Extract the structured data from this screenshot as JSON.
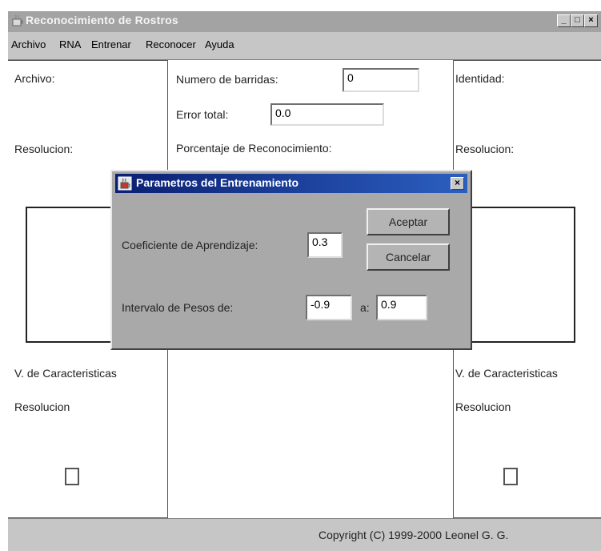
{
  "window": {
    "title": "Reconocimiento de Rostros",
    "controls": {
      "minimize": "_",
      "maximize": "□",
      "close": "×"
    }
  },
  "menu": [
    "Archivo",
    "RNA",
    "Entrenar",
    "Reconocer",
    "Ayuda"
  ],
  "left_panel": {
    "archivo_label": "Archivo:",
    "resolucion_label": "Resolucion:",
    "vector_label": "V. de Caracteristicas",
    "resolucion2_label": "Resolucion"
  },
  "center_panel": {
    "barridas_label": "Numero de barridas:",
    "barridas_value": "0",
    "error_label": "Error total:",
    "error_value": "0.0",
    "porcentaje_label": "Porcentaje de Reconocimiento:"
  },
  "right_panel": {
    "identidad_label": "Identidad:",
    "resolucion_label": "Resolucion:",
    "vector_label": "V. de Caracteristicas",
    "resolucion2_label": "Resolucion"
  },
  "status": {
    "copyright": "Copyright (C) 1999-2000 Leonel G. G."
  },
  "dialog": {
    "title": "Parametros del Entrenamiento",
    "close": "×",
    "coef_label": "Coeficiente de Aprendizaje:",
    "coef_value": "0.3",
    "intervalo_label": "Intervalo de Pesos de:",
    "min_value": "-0.9",
    "a_label": "a:",
    "max_value": "0.9",
    "accept_label": "Aceptar",
    "cancel_label": "Cancelar"
  },
  "icons": {
    "app": "java-cup-icon",
    "dialog": "java-cup-icon"
  }
}
